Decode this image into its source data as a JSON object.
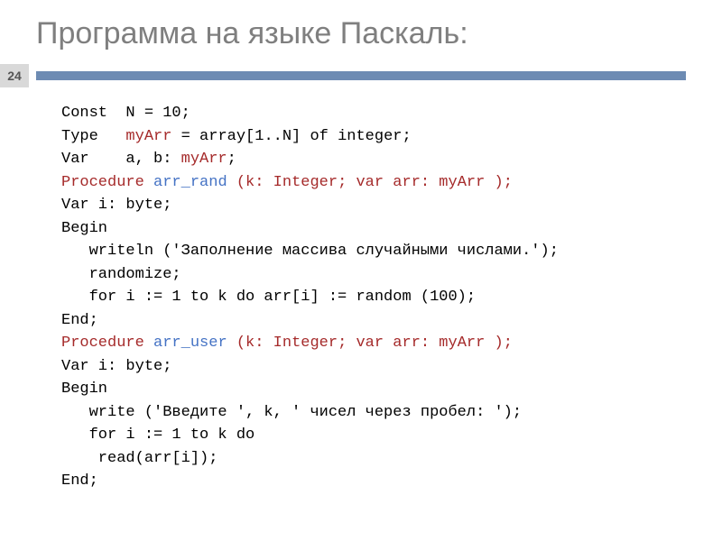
{
  "slide": {
    "title": "Программа на языке Паскаль:",
    "pageNumber": "24"
  },
  "code": {
    "l1a": "Const  N = 10;",
    "l2a": "Type   ",
    "l2b": "myArr",
    "l2c": " = array[1..N] of integer;",
    "l3a": "Var    a, b: ",
    "l3b": "myArr",
    "l3c": ";",
    "blank1": "",
    "l4a": "Procedure ",
    "l4b": "arr_rand",
    "l4c": " (k: Integer; var arr: ",
    "l4d": "myArr",
    "l4e": " );",
    "l5": "Var i: byte;",
    "l6": "Begin",
    "l7": "   writeln ('Заполнение массива случайными числами.');",
    "l8": "   randomize;",
    "l9": "   for i := 1 to k do arr[i] := random (100);",
    "l10": "End;",
    "blank2": "",
    "l11a": "Procedure ",
    "l11b": "arr_user",
    "l11c": " (k: Integer; var arr: ",
    "l11d": "myArr",
    "l11e": " );",
    "l12": "Var i: byte;",
    "l13": "Begin",
    "l14": "   write ('Введите ', k, ' чисел через пробел: ');",
    "l15": "   for i := 1 to k do",
    "l16": "    read(arr[i]);",
    "l17": "End;"
  }
}
